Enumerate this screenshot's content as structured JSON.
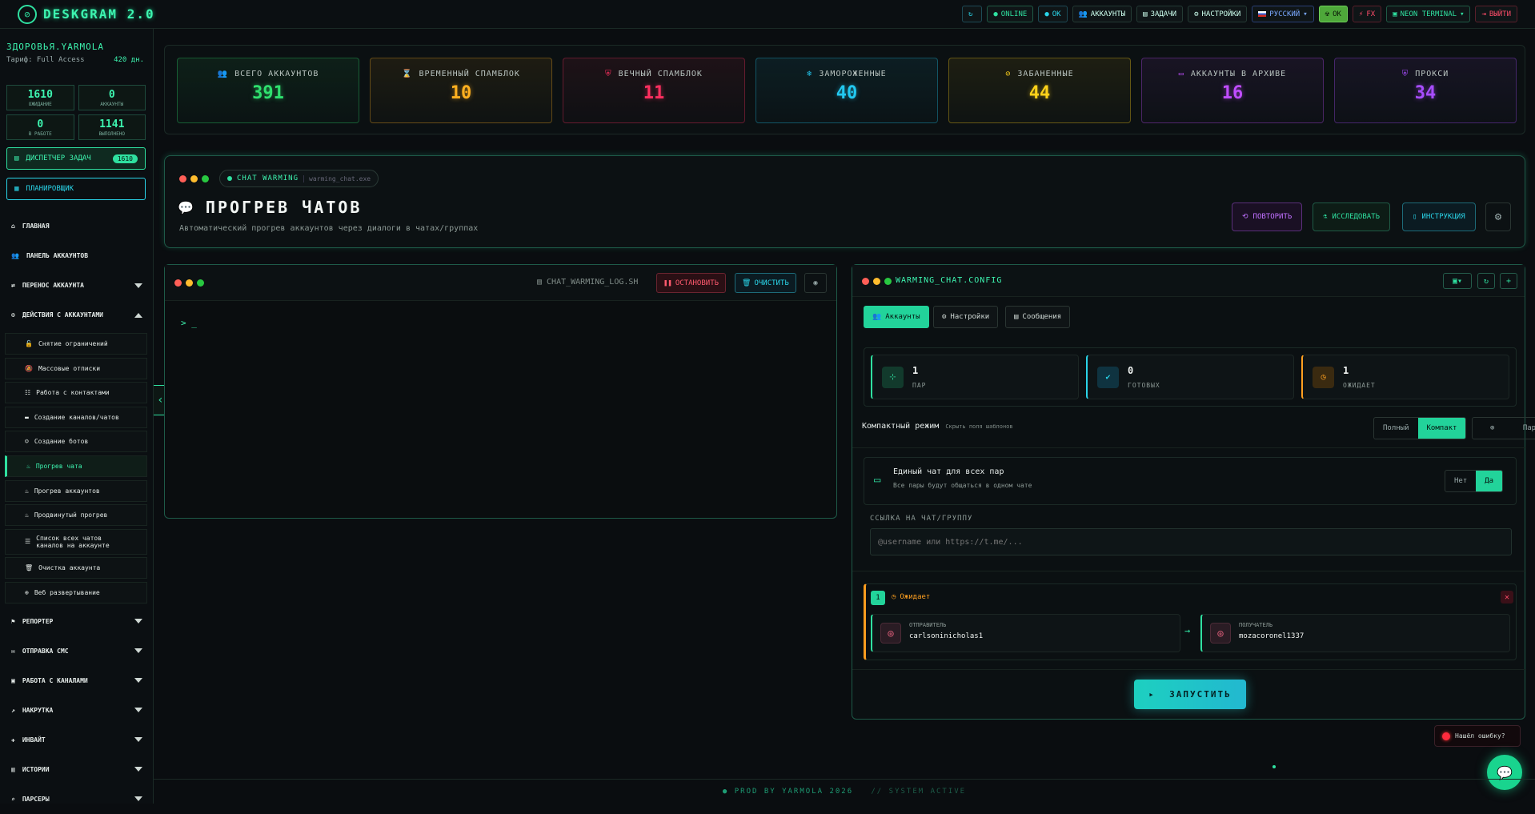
{
  "header": {
    "app_name": "DESKGRAM 2.0",
    "buttons": [
      {
        "label": "",
        "icon": "refresh-icon"
      },
      {
        "label": "ONLINE",
        "icon": "dot-icon"
      },
      {
        "label": "OK",
        "icon": "dot-icon"
      },
      {
        "label": "АККАУНТЫ",
        "icon": "users-icon"
      },
      {
        "label": "ЗАДАЧИ",
        "icon": "clipboard-icon"
      },
      {
        "label": "НАСТРОЙКИ",
        "icon": "gear-icon"
      },
      {
        "label": "РУССКИЙ",
        "icon": "flag-ru-icon"
      },
      {
        "label": "ОК",
        "icon": "radiation-icon"
      },
      {
        "label": "FX",
        "icon": "bolt-icon"
      },
      {
        "label": "NEON TERMINAL",
        "icon": "terminal-icon"
      },
      {
        "label": "ВЫЙТИ",
        "icon": "logout-icon"
      }
    ]
  },
  "sidebar": {
    "user": "ЗДОРОВЬЯ.YARMOLA",
    "tariff_label": "Тариф: Full Access",
    "tariff_days": "420 дн.",
    "stats": [
      {
        "value": "1610",
        "label": "ОЖИДАНИЕ"
      },
      {
        "value": "0",
        "label": "АККАУНТЫ"
      },
      {
        "value": "0",
        "label": "В РАБОТЕ"
      },
      {
        "value": "1141",
        "label": "ВЫПОЛНЕНО"
      }
    ],
    "dispatcher_label": "ДИСПЕТЧЕР ЗАДАЧ",
    "dispatcher_count": "1610",
    "scheduler_label": "ПЛАНИРОВЩИК",
    "nav_top": [
      {
        "label": "ГЛАВНАЯ",
        "icon": "home-icon",
        "chevron": ""
      },
      {
        "label": "ПАНЕЛЬ АККАУНТОВ",
        "icon": "users-icon",
        "chevron": ""
      },
      {
        "label": "ПЕРЕНОС АККАУНТА",
        "icon": "user-transfer-icon",
        "chevron": "down"
      },
      {
        "label": "ДЕЙСТВИЯ С АККАУНТАМИ",
        "icon": "user-gear-icon",
        "chevron": "up"
      }
    ],
    "sub_items": [
      {
        "label": "Снятие ограничений",
        "icon": "unlock-icon"
      },
      {
        "label": "Массовые отписки",
        "icon": "bell-off-icon"
      },
      {
        "label": "Работа с контактами",
        "icon": "contacts-icon"
      },
      {
        "label": "Создание каналов/чатов",
        "icon": "chat-icon"
      },
      {
        "label": "Создание ботов",
        "icon": "robot-icon"
      },
      {
        "label": "Прогрев чата",
        "icon": "flame-icon"
      },
      {
        "label": "Прогрев аккаунтов",
        "icon": "flame-icon"
      },
      {
        "label": "Продвинутый прогрев",
        "icon": "flame-icon"
      },
      {
        "label": "Список всех чатов каналов на аккаунте",
        "icon": "list-icon"
      },
      {
        "label": "Очистка аккаунта",
        "icon": "trash-icon"
      },
      {
        "label": "Веб развертывание",
        "icon": "globe-icon"
      }
    ],
    "nav_bottom": [
      {
        "label": "РЕПОРТЕР",
        "icon": "flag-icon"
      },
      {
        "label": "ОТПРАВКА СМС",
        "icon": "sms-icon"
      },
      {
        "label": "РАБОТА С КАНАЛАМИ",
        "icon": "briefcase-icon"
      },
      {
        "label": "НАКРУТКА",
        "icon": "chart-icon"
      },
      {
        "label": "ИНВАЙТ",
        "icon": "user-plus-icon"
      },
      {
        "label": "ИСТОРИИ",
        "icon": "film-icon"
      },
      {
        "label": "ПАРСЕРЫ",
        "icon": "search-icon"
      }
    ]
  },
  "stat_cards": [
    {
      "label": "ВСЕГО АККАУНТОВ",
      "value": "391",
      "color": "#2fe06e",
      "icon": "users-icon"
    },
    {
      "label": "ВРЕМЕННЫЙ СПАМБЛОК",
      "value": "10",
      "color": "#ffb020",
      "icon": "hourglass-icon"
    },
    {
      "label": "ВЕЧНЫЙ СПАМБЛОК",
      "value": "11",
      "color": "#ff2f5f",
      "icon": "shield-icon"
    },
    {
      "label": "ЗАМОРОЖЕННЫЕ",
      "value": "40",
      "color": "#22c8f0",
      "icon": "snowflake-icon"
    },
    {
      "label": "ЗАБАНЕННЫЕ",
      "value": "44",
      "color": "#ffd21a",
      "icon": "ban-icon"
    },
    {
      "label": "АККАУНТЫ В АРХИВЕ",
      "value": "16",
      "color": "#c04dff",
      "icon": "archive-icon"
    },
    {
      "label": "ПРОКСИ",
      "value": "34",
      "color": "#a84dff",
      "icon": "proxy-shield-icon"
    }
  ],
  "hero": {
    "badge_name": "CHAT WARMING",
    "badge_exe": "warming_chat.exe",
    "title": "ПРОГРЕВ ЧАТОВ",
    "description": "Автоматический прогрев аккаунтов через диалоги в чатах/группах",
    "buttons": [
      {
        "label": "ПОВТОРИТЬ",
        "icon": "repeat-icon",
        "color": "#c070ff"
      },
      {
        "label": "ИССЛЕДОВАТЬ",
        "icon": "flask-icon",
        "color": "#2fe0a0"
      },
      {
        "label": "ИНСТРУКЦИЯ",
        "icon": "book-icon",
        "color": "#2ad4e8"
      }
    ]
  },
  "terminal": {
    "filename": "CHAT_WARMING_LOG.SH",
    "stop_label": "ОСТАНОВИТЬ",
    "clear_label": "ОЧИСТИТЬ",
    "prompt": "> _"
  },
  "config": {
    "title": "WARMING_CHAT.CONFIG",
    "tabs": [
      "Аккаунты",
      "Настройки",
      "Сообщения"
    ],
    "metrics": [
      {
        "value": "1",
        "label": "ПАР",
        "color": "#2fe0a0",
        "icon": "network-icon"
      },
      {
        "value": "0",
        "label": "ГОТОВЫХ",
        "color": "#2ad4e8",
        "icon": "check-circle-icon"
      },
      {
        "value": "1",
        "label": "ОЖИДАЕТ",
        "color": "#ffa020",
        "icon": "clock-icon"
      }
    ],
    "compact_label": "Компактный режим",
    "compact_hint": "Скрыть поля шаблонов",
    "mode_full": "Полный",
    "mode_compact": "Компакт",
    "add_pair_label": "Пара",
    "single_chat_title": "Единый чат для всех пар",
    "single_chat_desc": "Все пары будут общаться в одном чате",
    "no_label": "Нет",
    "yes_label": "Да",
    "link_label": "ССЫЛКА НА ЧАТ/ГРУППУ",
    "link_placeholder": "@username или https://t.me/...",
    "pair_index": "1",
    "pair_status": "Ожидает",
    "sender_key": "ОТПРАВИТЕЛЬ",
    "sender_value": "carlsoninicholas1",
    "receiver_key": "ПОЛУЧАТЕЛЬ",
    "receiver_value": "mozacoronel1337",
    "run_label": "ЗАПУСТИТЬ"
  },
  "bug_label": "Нашёл ошибку?",
  "footer": {
    "left": "PROD BY YARMOLA 2026",
    "right": "// SYSTEM ACTIVE"
  }
}
